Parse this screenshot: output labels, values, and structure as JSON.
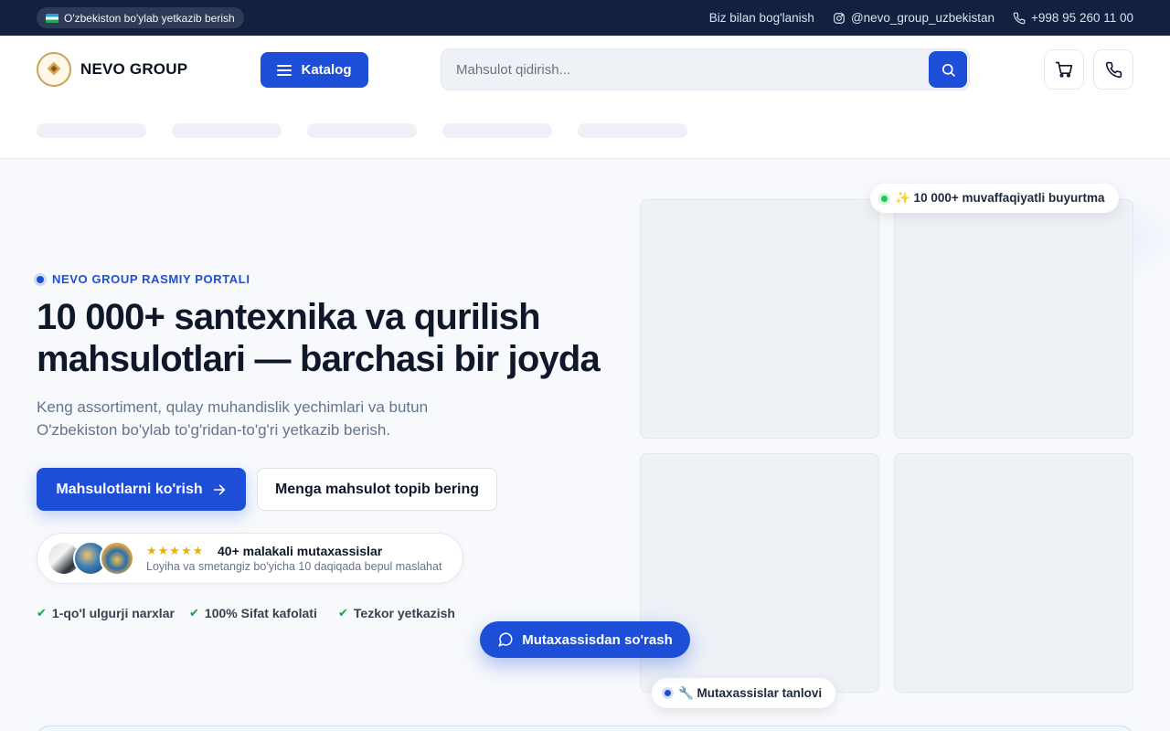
{
  "topbar": {
    "delivery": "O'zbekiston bo'ylab yetkazib berish",
    "contact": "Biz bilan bog'lanish",
    "instagram": "@nevo_group_uzbekistan",
    "phone": "+998 95 260 11 00"
  },
  "header": {
    "brand": "NEVO GROUP",
    "catalog_label": "Katalog",
    "search_placeholder": "Mahsulot qidirish...",
    "icons": [
      "cart-icon",
      "phone-icon"
    ]
  },
  "hero": {
    "tag": "NEVO GROUP RASMIY PORTALI",
    "title": "10 000+ santexnika va qurilish mahsulotlari — barchasi bir joyda",
    "subtitle": "Keng assortiment, qulay muhandislik yechimlari va butun O'zbekiston bo'ylab to'g'ridan-to'g'ri yetkazib berish.",
    "primary_cta": "Mahsulotlarni ko'rish",
    "secondary_cta": "Menga mahsulot topib bering",
    "experts": {
      "stars": "★★★★★",
      "title": "40+ malakali mutaxassislar",
      "subtitle": "Loyiha va smetangiz bo'yicha 10 daqiqada bepul maslahat"
    },
    "features": [
      "1-qo'l ulgurji narxlar",
      "100% Sifat kafolati",
      "Tezkor yetkazish"
    ]
  },
  "badges": {
    "orders": "✨ 10 000+ muvaffaqiyatli buyurtma",
    "experts_choice": "🔧 Mutaxassislar tanlovi"
  },
  "ask_button": "Mutaxassisdan so'rash",
  "colors": {
    "primary": "#1d4ed8",
    "topbar": "#13203f",
    "star": "#eab308",
    "check": "#16a34a"
  }
}
